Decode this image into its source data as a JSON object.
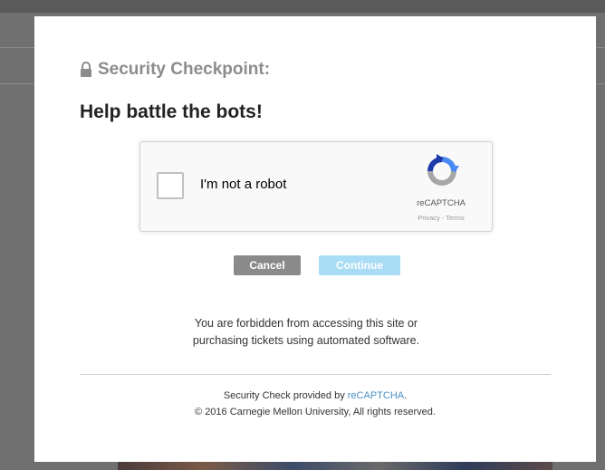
{
  "modal": {
    "checkpoint_title": "Security Checkpoint:",
    "headline": "Help battle the bots!",
    "lock_icon": "lock-icon"
  },
  "recaptcha": {
    "checkbox_label": "I'm not a robot",
    "brand": "reCAPTCHA",
    "links": "Privacy - Terms",
    "checked": false
  },
  "buttons": {
    "cancel_label": "Cancel",
    "continue_label": "Continue"
  },
  "warning": {
    "line1": "You are forbidden from accessing this site or",
    "line2": "purchasing tickets using automated software."
  },
  "footer": {
    "provided_prefix": "Security Check provided by ",
    "provided_link": "reCAPTCHA",
    "provided_suffix": ".",
    "copyright": "© 2016 Carnegie Mellon University, All rights reserved."
  },
  "colors": {
    "cancel_bg": "#8a8a8a",
    "continue_bg": "#a9dcf5",
    "link": "#4a90c2",
    "recaptcha_blue": "#4a8af4",
    "recaptcha_dark_blue": "#1c3aa9",
    "recaptcha_gray": "#a6a6a6"
  }
}
